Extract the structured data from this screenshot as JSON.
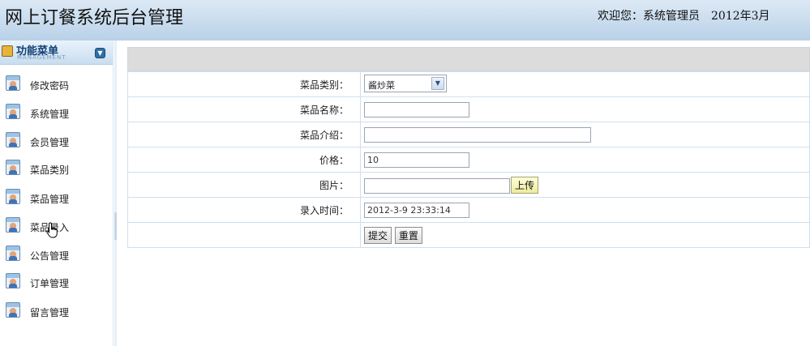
{
  "header": {
    "title": "网上订餐系统后台管理",
    "welcome": "欢迎您：系统管理员",
    "date": "2012年3月"
  },
  "sidebar": {
    "title": "功能菜单",
    "subtitle": "MANAGEMENT",
    "items": [
      {
        "label": "修改密码"
      },
      {
        "label": "系统管理"
      },
      {
        "label": "会员管理"
      },
      {
        "label": "菜品类别"
      },
      {
        "label": "菜品管理"
      },
      {
        "label": "菜品录入"
      },
      {
        "label": "公告管理"
      },
      {
        "label": "订单管理"
      },
      {
        "label": "留言管理"
      }
    ]
  },
  "form": {
    "category_label": "菜品类别：",
    "category_value": "酱炒菜",
    "name_label": "菜品名称：",
    "name_value": "",
    "intro_label": "菜品介绍：",
    "intro_value": "",
    "price_label": "价格：",
    "price_value": "10",
    "image_label": "图片：",
    "image_value": "",
    "upload_label": "上传",
    "time_label": "录入时间：",
    "time_value": "2012-3-9 23:33:14",
    "submit_label": "提交",
    "reset_label": "重置"
  },
  "icons": {
    "menu_item": "user-card-icon",
    "header": "folder-icon",
    "collapse": "collapse-icon",
    "dropdown": "chevron-down-icon",
    "cursor": "hand-cursor-icon"
  }
}
